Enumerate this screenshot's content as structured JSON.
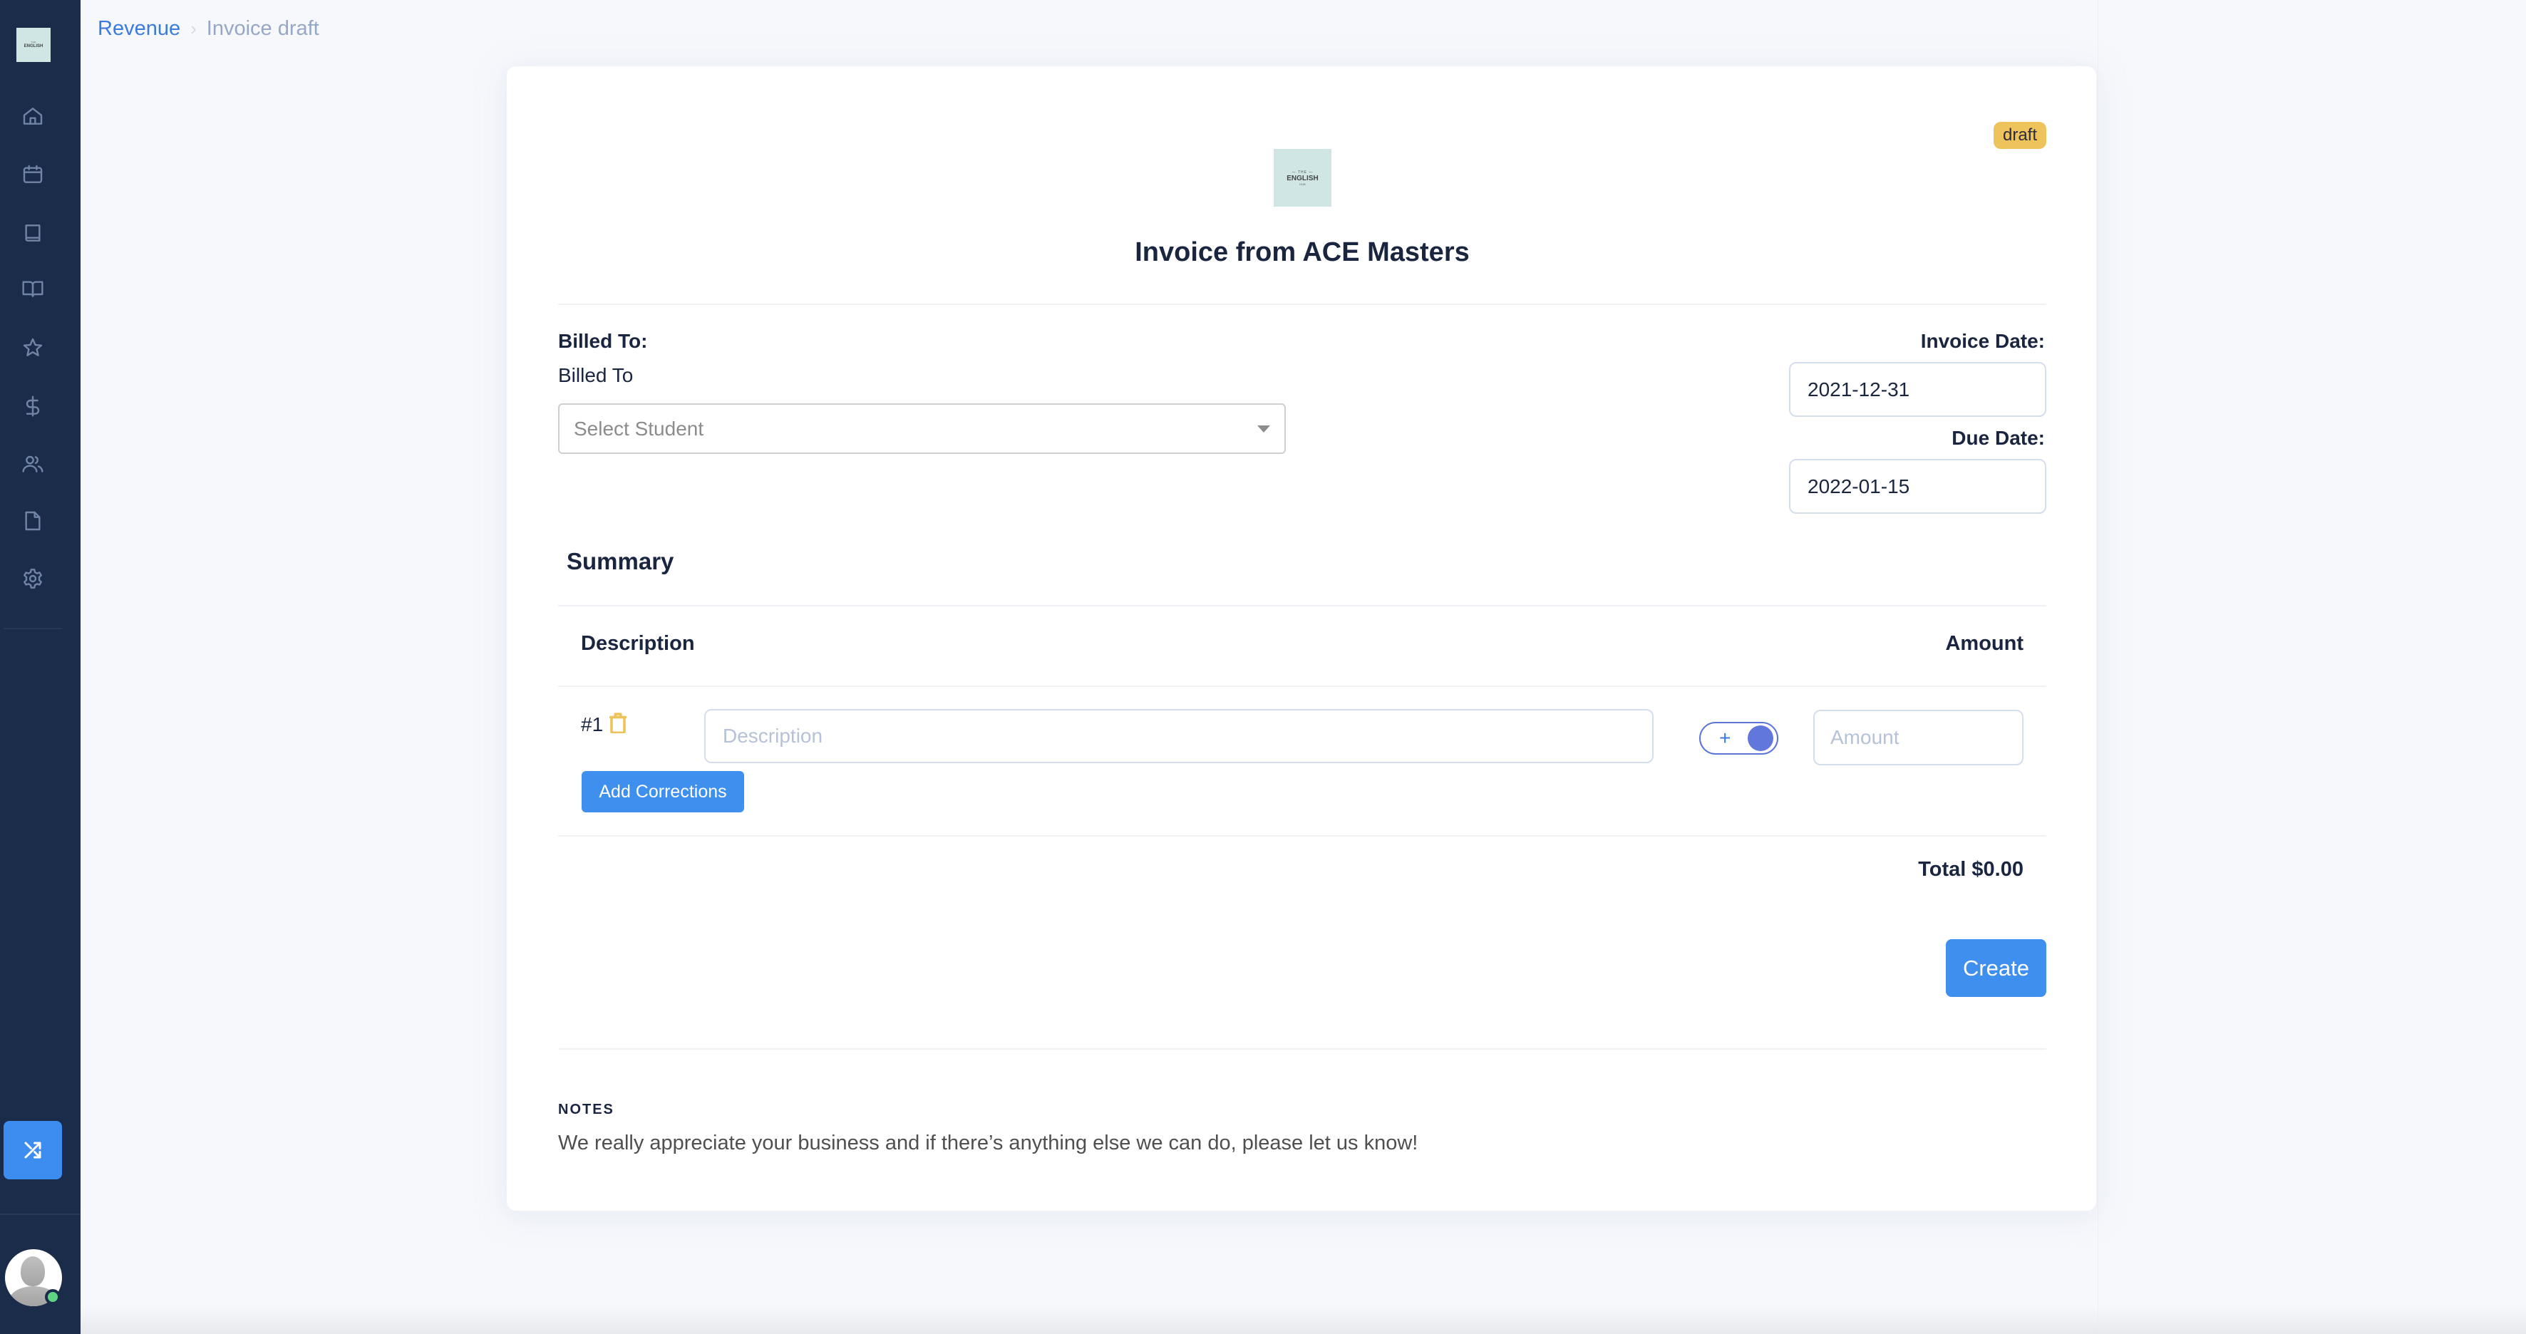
{
  "sidebar": {
    "logo": {
      "small": "THE",
      "main": "ENGLISH",
      "tiny": "HUB"
    },
    "items": [
      {
        "name": "home",
        "icon": "home-icon"
      },
      {
        "name": "calendar",
        "icon": "calendar-icon"
      },
      {
        "name": "book",
        "icon": "book-icon"
      },
      {
        "name": "open-book",
        "icon": "open-book-icon"
      },
      {
        "name": "star",
        "icon": "star-icon"
      },
      {
        "name": "revenue",
        "icon": "dollar-icon"
      },
      {
        "name": "users",
        "icon": "users-icon"
      },
      {
        "name": "documents",
        "icon": "file-icon"
      },
      {
        "name": "settings",
        "icon": "gear-icon"
      }
    ],
    "action_icon": "shuffle-icon",
    "user_status": "online"
  },
  "breadcrumb": {
    "parent": "Revenue",
    "separator": "›",
    "current": "Invoice draft"
  },
  "invoice": {
    "status_badge": "draft",
    "logo": {
      "small": "— THE —",
      "main": "ENGLISH",
      "tiny": "HUB"
    },
    "title": "Invoice from ACE Masters",
    "billed_to_label": "Billed To:",
    "billed_to_sublabel": "Billed To",
    "student_select": {
      "placeholder": "Select Student",
      "value": ""
    },
    "invoice_date_label": "Invoice Date:",
    "invoice_date": "2021-12-31",
    "due_date_label": "Due Date:",
    "due_date": "2022-01-15"
  },
  "summary": {
    "title": "Summary",
    "columns": [
      "Description",
      "Amount"
    ],
    "rows": [
      {
        "number": "#1",
        "description": {
          "placeholder": "Description",
          "value": ""
        },
        "toggle_symbol": "+",
        "toggle_on": true,
        "amount": {
          "placeholder": "Amount",
          "value": ""
        }
      }
    ],
    "add_corrections_label": "Add Corrections",
    "total_label": "Total $0.00",
    "create_label": "Create"
  },
  "notes": {
    "label": "NOTES",
    "text": "We really appreciate your business and if there’s anything else we can do, please let us know!"
  },
  "colors": {
    "sidebar_bg": "#1b2c4b",
    "accent_blue": "#3f8fee",
    "draft_badge": "#eec35c",
    "toggle": "#6177dc",
    "online": "#5ed483"
  }
}
